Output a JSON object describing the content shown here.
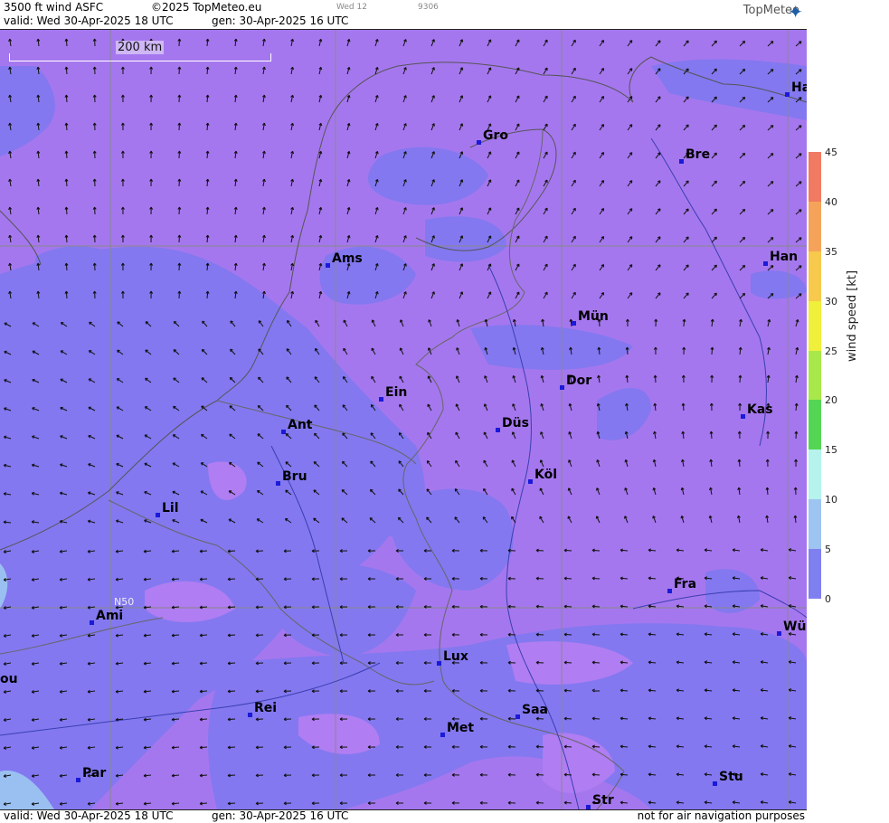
{
  "header": {
    "product": "3500 ft wind ASFC",
    "copyright": "©2025 TopMeteo.eu",
    "small_day": "Wed 12",
    "small_code": "9306",
    "valid": "valid:  Wed  30-Apr-2025  18 UTC",
    "gen": "gen: 30-Apr-2025 16 UTC",
    "brand": "TopMeteo"
  },
  "footer": {
    "valid": "valid:  Wed  30-Apr-2025  18 UTC",
    "gen": "gen: 30-Apr-2025 16 UTC",
    "disclaimer": "not for air navigation purposes"
  },
  "scale": {
    "label": "200 km"
  },
  "grid_label": "N50",
  "legend": {
    "unit": "wind speed [kt]",
    "ticks": [
      "45",
      "40",
      "35",
      "30",
      "25",
      "20",
      "15",
      "10",
      "5",
      "0"
    ],
    "colors": [
      "#f07a62",
      "#f5a35a",
      "#f7c94c",
      "#efef3c",
      "#a8e84a",
      "#54d654",
      "#b5f3ec",
      "#9ec4f2",
      "#7f80f0",
      "#b684f2"
    ]
  },
  "cities": [
    {
      "name": "Gro"
    },
    {
      "name": "Bre"
    },
    {
      "name": "Ha"
    },
    {
      "name": "Ams"
    },
    {
      "name": "Han"
    },
    {
      "name": "Mün"
    },
    {
      "name": "Ein"
    },
    {
      "name": "Dor"
    },
    {
      "name": "Ant"
    },
    {
      "name": "Düs"
    },
    {
      "name": "Kas"
    },
    {
      "name": "Bru"
    },
    {
      "name": "Köl"
    },
    {
      "name": "Lil"
    },
    {
      "name": "Fra"
    },
    {
      "name": "Ami"
    },
    {
      "name": "Wü"
    },
    {
      "name": "ou"
    },
    {
      "name": "Lux"
    },
    {
      "name": "Rei"
    },
    {
      "name": "Saa"
    },
    {
      "name": "Met"
    },
    {
      "name": "Par"
    },
    {
      "name": "Stu"
    },
    {
      "name": "Str"
    }
  ]
}
